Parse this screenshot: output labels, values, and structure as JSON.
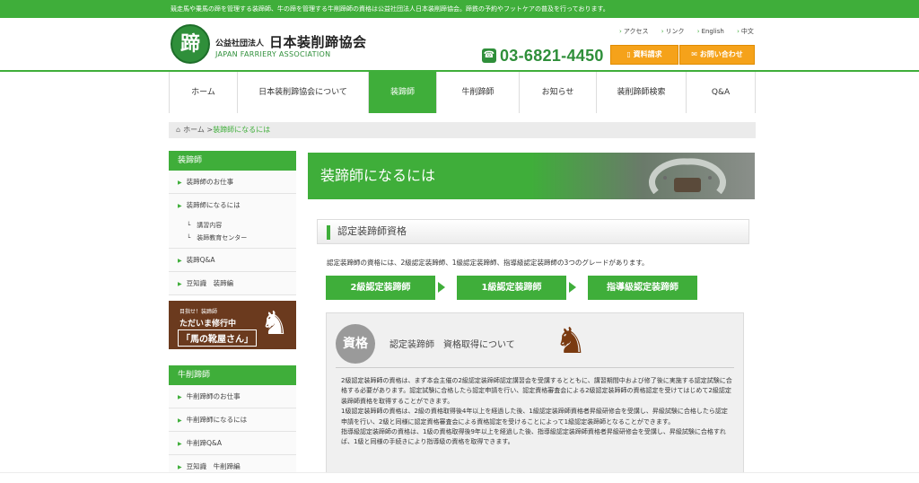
{
  "topbar": {
    "text": "競走馬や乗馬の蹄を管理する装蹄師、牛の蹄を管理する牛削蹄師の資格は公益社団法人日本装削蹄協会。蹄鉄の予約やフットケアの普及を行っております。"
  },
  "header": {
    "logo_glyph": "蹄",
    "org_sub": "公益社団法人",
    "org_name": "日本装削蹄協会",
    "org_en": "JAPAN FARRIERY ASSOCIATION",
    "phone": "03-6821-4450",
    "phone_icon": "☎",
    "btn_doc": "資料請求",
    "btn_mail": "お問い合わせ",
    "links": [
      "アクセス",
      "リンク",
      "English",
      "中文"
    ]
  },
  "nav": [
    {
      "label": "ホーム",
      "active": false
    },
    {
      "label": "日本装削蹄協会について",
      "active": false
    },
    {
      "label": "装蹄師",
      "active": true
    },
    {
      "label": "牛削蹄師",
      "active": false
    },
    {
      "label": "お知らせ",
      "active": false
    },
    {
      "label": "装削蹄師検索",
      "active": false
    },
    {
      "label": "Q&A",
      "active": false
    }
  ],
  "breadcrumb": {
    "home": "ホーム",
    "sep": ">",
    "current": "装蹄師になるには"
  },
  "sidebar": {
    "sec1_head": "装蹄師",
    "sec1_items": [
      "装蹄師のお仕事",
      "装蹄師になるには"
    ],
    "sec1_subs": [
      "講習内容",
      "装蹄教育センター"
    ],
    "sec1_items2": [
      "装蹄Q&A",
      "豆知識　装蹄編"
    ],
    "banner": {
      "l1": "目指せ！装蹄師",
      "l2": "ただいま修行中",
      "l3": "「馬の靴屋さん」"
    },
    "sec2_head": "牛削蹄師",
    "sec2_items": [
      "牛削蹄師のお仕事",
      "牛削蹄師になるには",
      "牛削蹄Q&A",
      "豆知識　牛削蹄編"
    ]
  },
  "main": {
    "title": "装蹄師になるには",
    "section_head": "認定装蹄師資格",
    "intro": "認定装蹄師の資格には、2級認定装蹄師、1級認定装蹄師、指導級認定装蹄師の3つのグレードがあります。",
    "grades": [
      "2級認定装蹄師",
      "1級認定装蹄師",
      "指導級認定装蹄師"
    ],
    "box": {
      "badge": "資格",
      "title": "認定装蹄師　資格取得について",
      "paragraphs": [
        "2級認定装蹄師の資格は、まず本会主催の2級認定装蹄師認定講習会を受講するとともに、講習期間中および修了後に実施する認定試験に合格する必要があります。認定試験に合格したら認定申請を行い、認定資格審査会による2級認定装蹄師の資格認定を受けてはじめて2級認定装蹄師資格を取得することができます。",
        "1級認定装蹄師の資格は、2級の資格取得後4年以上を経過した後、1級認定装蹄師資格者昇級研修会を受講し、昇級試験に合格したら認定申請を行い、2級と同様に認定資格審査会による資格認定を受けることによって1級認定装蹄師となることができます。",
        "指導級認定装蹄師の資格は、1級の資格取得後9年以上を経過した後、指導級認定装蹄師資格者昇級研修会を受講し、昇級試験に合格すれば、1級と同様の手続きにより指導級の資格を取得できます。"
      ]
    }
  }
}
